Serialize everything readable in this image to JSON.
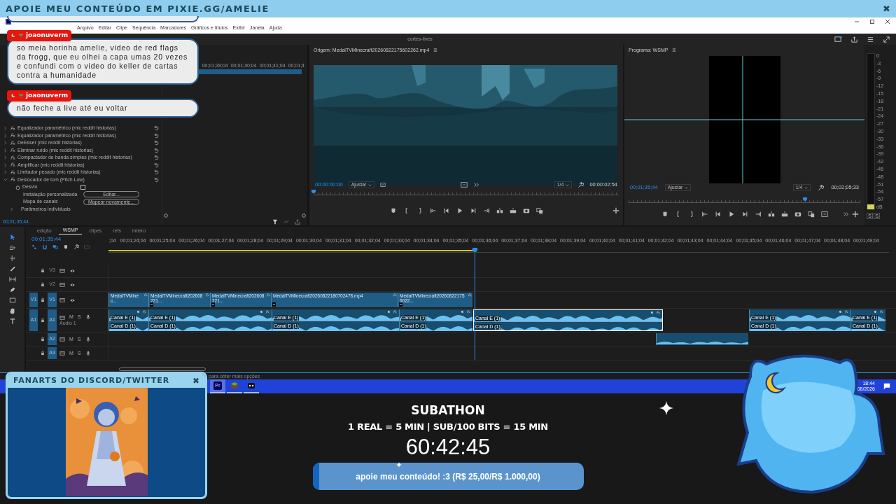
{
  "banner": {
    "text": "APOIE MEU CONTEÚDO EM PIXIE.GG/AMELIE",
    "close": "✖"
  },
  "chat": {
    "messages": [
      {
        "user": "joaonuverm",
        "text": "so meia horinha amelie, video de red flags da frogg, que eu olhei a capa umas 20 vezes e confundi com o video do keller de cartas contra a humanidade"
      },
      {
        "user": "joaonuverm",
        "text": "não feche a live até eu voltar"
      }
    ]
  },
  "app": {
    "menu": [
      "Arquivo",
      "Editar",
      "Clipe",
      "Sequência",
      "Marcadores",
      "Gráficos e títulos",
      "Exibir",
      "Janela",
      "Ajuda"
    ],
    "project": "cortes-lives"
  },
  "effects": {
    "items": [
      {
        "name": "Equalizador paramétrico (mic reddit historias)",
        "expanded": false
      },
      {
        "name": "Equalizador paramétrico (mic reddit historias)",
        "expanded": false
      },
      {
        "name": "DeEsser (mic reddit historias)",
        "expanded": false
      },
      {
        "name": "Eliminar ruído (mic reddit historias)",
        "expanded": false
      },
      {
        "name": "Compactador de banda simples (mic reddit historias)",
        "expanded": false
      },
      {
        "name": "Amplificar (mic reddit historias)",
        "expanded": false
      },
      {
        "name": "Limitador pesado (mic reddit historias)",
        "expanded": false
      },
      {
        "name": "Deslocador de tom (Pitch Low)",
        "expanded": true,
        "params": [
          {
            "kind": "checkbox",
            "label": "Desvio",
            "checked": false
          },
          {
            "kind": "button",
            "label": "Instalação personalizada",
            "button": "Editar..."
          },
          {
            "kind": "button",
            "label": "Mapa de canais",
            "button": "Mapear novamente..."
          },
          {
            "kind": "group",
            "label": "Parâmetros individuais",
            "expanded": false
          }
        ]
      }
    ],
    "timecode": "00;01;35;44"
  },
  "mini_ruler": [
    "00;01;39;04",
    "00;01;40;04",
    "00;01;41;04",
    "00;01;4"
  ],
  "source": {
    "title": "Origem: MedalTVMinecraft20260822175602262.mp4",
    "timecode": "00:00:00:00",
    "fit": "Ajustar",
    "zoom": "1/4",
    "duration": "00:00:02:54",
    "level": 0
  },
  "program": {
    "title": "Programa: WSMP",
    "timecode": "00;01;35;44",
    "fit": "Ajustar",
    "zoom": "1/4",
    "duration": "00;02;05;33",
    "level": 0.76
  },
  "meter": {
    "level": 0.03,
    "scale": [
      "0",
      "-3",
      "-6",
      "-9",
      "-12",
      "-15",
      "-18",
      "-21",
      "-24",
      "-27",
      "-30",
      "-33",
      "-36",
      "-39",
      "-42",
      "-45",
      "-48",
      "-51",
      "-54",
      "-57",
      "dB"
    ],
    "buttons": [
      "S",
      "S"
    ]
  },
  "timeline": {
    "tabs": [
      {
        "label": "edição",
        "selected": false
      },
      {
        "label": "WSMP",
        "selected": true
      },
      {
        "label": "clipes",
        "selected": false
      },
      {
        "label": "refs",
        "selected": false
      },
      {
        "label": "inteiro",
        "selected": false
      }
    ],
    "timecode": "00;01;35;44",
    "ruler": [
      ";04",
      "00;01;24;04",
      "00;01;25;04",
      "00;01;26;04",
      "00;01;27;04",
      "00;01;28;04",
      "00;01;29;04",
      "00;01;30;04",
      "00;01;31;04",
      "00;01;32;04",
      "00;01;33;04",
      "00;01;34;04",
      "00;01;35;04",
      "00;01;36;04",
      "00;01;37;04",
      "00;01;38;04",
      "00;01;39;04",
      "00;01;40;04",
      "00;01;41;04",
      "00;01;42;04",
      "00;01;43;04",
      "00;01;44;04",
      "00;01;45;04",
      "00;01;46;04",
      "00;01;47;04",
      "00;01;48;04",
      "00;01;49;04"
    ],
    "tracks": [
      {
        "kind": "video",
        "name": "V3",
        "targeted": false
      },
      {
        "kind": "video",
        "name": "V2",
        "targeted": false
      },
      {
        "kind": "video",
        "source": "V1",
        "name": "V1",
        "targeted": true
      },
      {
        "kind": "audio",
        "source": "A1",
        "name": "A1",
        "targeted": true,
        "label": "Áudio 1",
        "buttons": [
          "M",
          "S"
        ]
      },
      {
        "kind": "audio",
        "name": "A2",
        "targeted": true,
        "buttons": [
          "M",
          "S"
        ]
      },
      {
        "kind": "audio",
        "name": "A3",
        "targeted": true,
        "buttons": [
          "M",
          "S"
        ]
      }
    ],
    "video_clips": [
      {
        "name": "MedalTVMinec..."
      },
      {
        "name": "MedalTVMinecraft202608221..."
      },
      {
        "name": "MedalTVMinecraft202608221..."
      },
      {
        "name": "MedalTVMinecraft20260822180702478.mp4"
      },
      {
        "name": "MedalTVMinecraft202608221756022..."
      }
    ],
    "audio_clips": [
      {
        "labels": [
          "Canal E (1)",
          "Canal D (1)"
        ],
        "selected": false
      },
      {
        "labels": [
          "Canal E (1)",
          "Canal D (1)"
        ],
        "selected": false
      },
      {
        "labels": [
          "Canal E (1)",
          "Canal D (1)"
        ],
        "selected": false
      },
      {
        "labels": [
          "Canal E (1)",
          "Canal D (1)"
        ],
        "selected": false
      },
      {
        "labels": [
          "Canal E (1)",
          "Canal D (1)"
        ],
        "selected": true
      },
      {
        "labels": [
          "Canal E (1)",
          "Canal D (1)"
        ],
        "selected": false
      },
      {
        "labels": [
          "Canal E (1)",
          "Canal D (1)"
        ],
        "selected": false
      }
    ],
    "a2_clips": [
      {
        "selected": false
      }
    ]
  },
  "status_hint": "para obter mais opções",
  "taskbar": {
    "apps": [
      {
        "kind": "premiere",
        "label": "Pr",
        "selected": true
      },
      {
        "kind": "minecraft",
        "selected": false
      },
      {
        "kind": "discord",
        "selected": false
      }
    ],
    "time": "18:44",
    "date": "/08/2026"
  },
  "fanart": {
    "title": "FANARTS DO DISCORD/TWITTER",
    "close": "✖"
  },
  "subathon": {
    "title": "SUBATHON",
    "rates": "1 REAL = 5 MIN | SUB/100 BITS = 15 MIN",
    "timer": "60:42:45",
    "goal": {
      "text": "apoie meu conteúdo! :3 (R$ 25,00/R$ 1.000,00)",
      "level": 0.025
    }
  }
}
